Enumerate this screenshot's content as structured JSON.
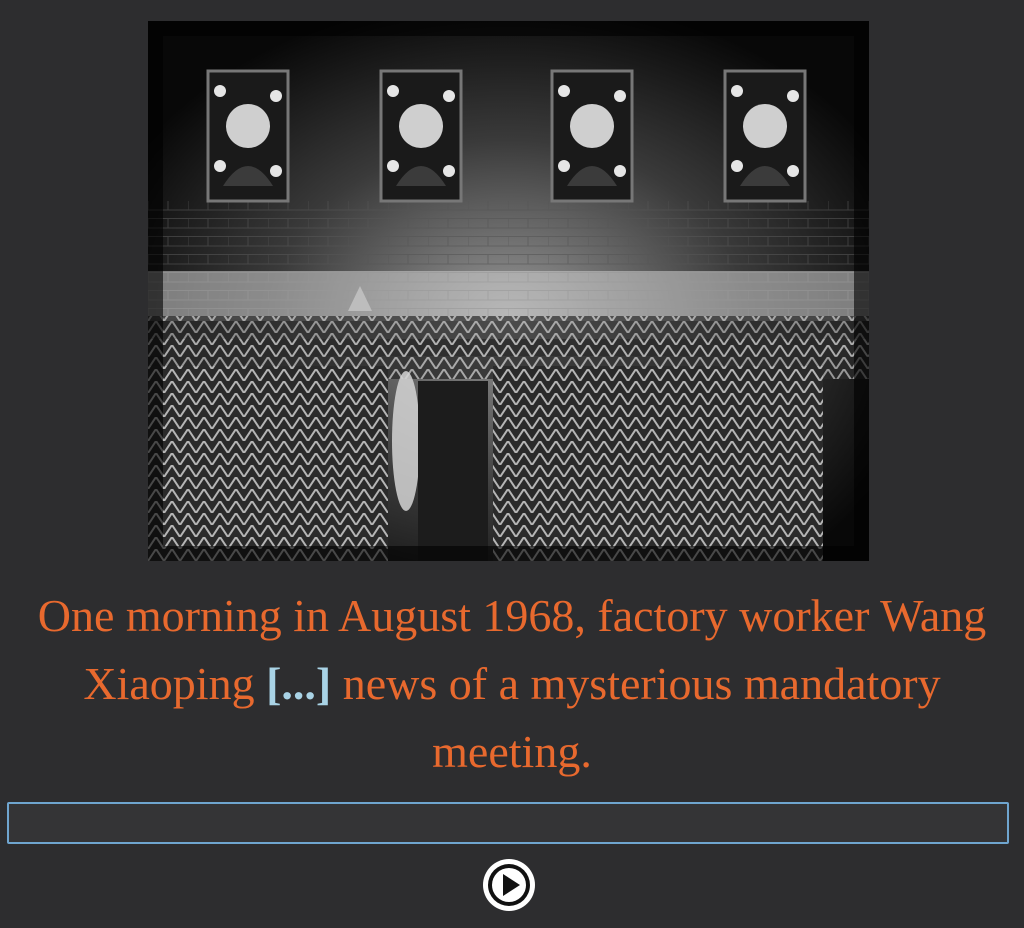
{
  "sentence": {
    "before": "One morning in August 1968, factory worker Wang Xiaoping ",
    "blank": "[...]",
    "after": " news of a mysterious mandatory meeting."
  },
  "answer": {
    "value": "",
    "placeholder": ""
  },
  "colors": {
    "background": "#2d2d2f",
    "sentence_text": "#e8692e",
    "blank_text": "#a9d3e6",
    "input_border": "#6fa5cf",
    "play_button": "#ffffff"
  },
  "icons": {
    "play": "play-icon"
  }
}
